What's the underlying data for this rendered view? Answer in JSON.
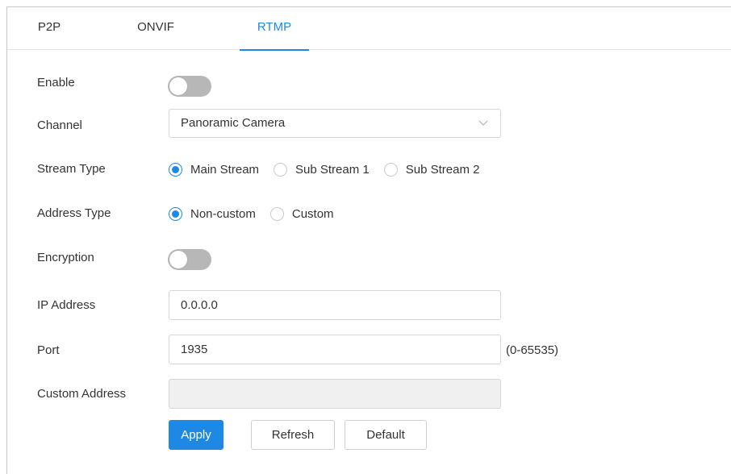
{
  "tabs": [
    {
      "label": "P2P"
    },
    {
      "label": "ONVIF"
    },
    {
      "label": "RTMP"
    }
  ],
  "active_tab": "RTMP",
  "form": {
    "enable": {
      "label": "Enable",
      "on": false
    },
    "channel": {
      "label": "Channel",
      "value": "Panoramic Camera"
    },
    "stream_type": {
      "label": "Stream Type",
      "options": [
        "Main Stream",
        "Sub Stream 1",
        "Sub Stream 2"
      ],
      "selected": "Main Stream"
    },
    "address_type": {
      "label": "Address Type",
      "options": [
        "Non-custom",
        "Custom"
      ],
      "selected": "Non-custom"
    },
    "encryption": {
      "label": "Encryption",
      "on": false
    },
    "ip_address": {
      "label": "IP Address",
      "value": "0.0.0.0"
    },
    "port": {
      "label": "Port",
      "value": "1935",
      "range_hint": "(0-65535)"
    },
    "custom_address": {
      "label": "Custom Address",
      "value": ""
    }
  },
  "buttons": {
    "apply": "Apply",
    "refresh": "Refresh",
    "default": "Default"
  },
  "colors": {
    "accent": "#1e88e5",
    "toggle_off": "#b7b7b7",
    "disabled_bg": "#f0f0f0"
  }
}
